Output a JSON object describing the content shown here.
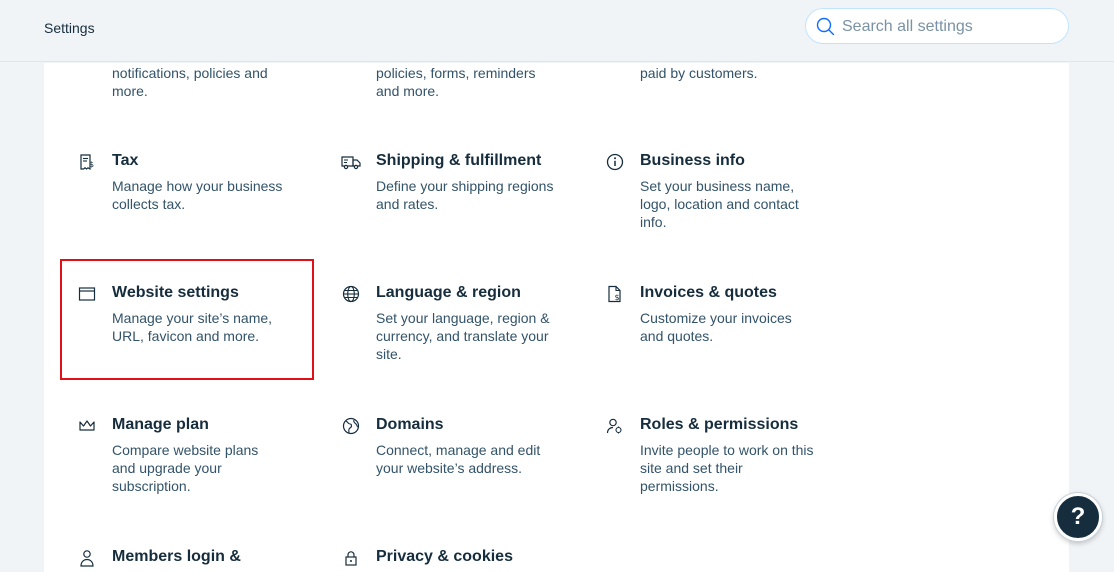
{
  "header": {
    "title": "Settings"
  },
  "search": {
    "placeholder": "Search all settings",
    "value": ""
  },
  "top_fragments": [
    {
      "text": "notifications, policies and more."
    },
    {
      "text": "policies, forms, reminders and more."
    },
    {
      "text": "paid by customers."
    }
  ],
  "items": [
    {
      "title": "Tax",
      "desc": "Manage how your business collects tax.",
      "icon": "tax-icon"
    },
    {
      "title": "Shipping & fulfillment",
      "desc": "Define your shipping regions and rates.",
      "icon": "truck-icon"
    },
    {
      "title": "Business info",
      "desc": "Set your business name, logo, location and contact info.",
      "icon": "info-icon"
    },
    {
      "title": "Website settings",
      "desc": "Manage your site’s name, URL, favicon and more.",
      "icon": "browser-window-icon"
    },
    {
      "title": "Language & region",
      "desc": "Set your language, region & currency, and translate your site.",
      "icon": "globe-icon"
    },
    {
      "title": "Invoices & quotes",
      "desc": "Customize your invoices and quotes.",
      "icon": "invoice-icon"
    },
    {
      "title": "Manage plan",
      "desc": "Compare website plans and upgrade your subscription.",
      "icon": "crown-icon"
    },
    {
      "title": "Domains",
      "desc": "Connect, manage and edit your website’s address.",
      "icon": "domain-globe-icon"
    },
    {
      "title": "Roles & permissions",
      "desc": "Invite people to work on this site and set their permissions.",
      "icon": "roles-icon"
    },
    {
      "title": "Members login &",
      "desc": "",
      "icon": "member-icon"
    },
    {
      "title": "Privacy & cookies",
      "desc": "",
      "icon": "lock-icon"
    }
  ],
  "help": {
    "label": "?"
  },
  "colors": {
    "accent": "#116dff",
    "highlight": "#e0101a",
    "text": "#162d3d"
  }
}
